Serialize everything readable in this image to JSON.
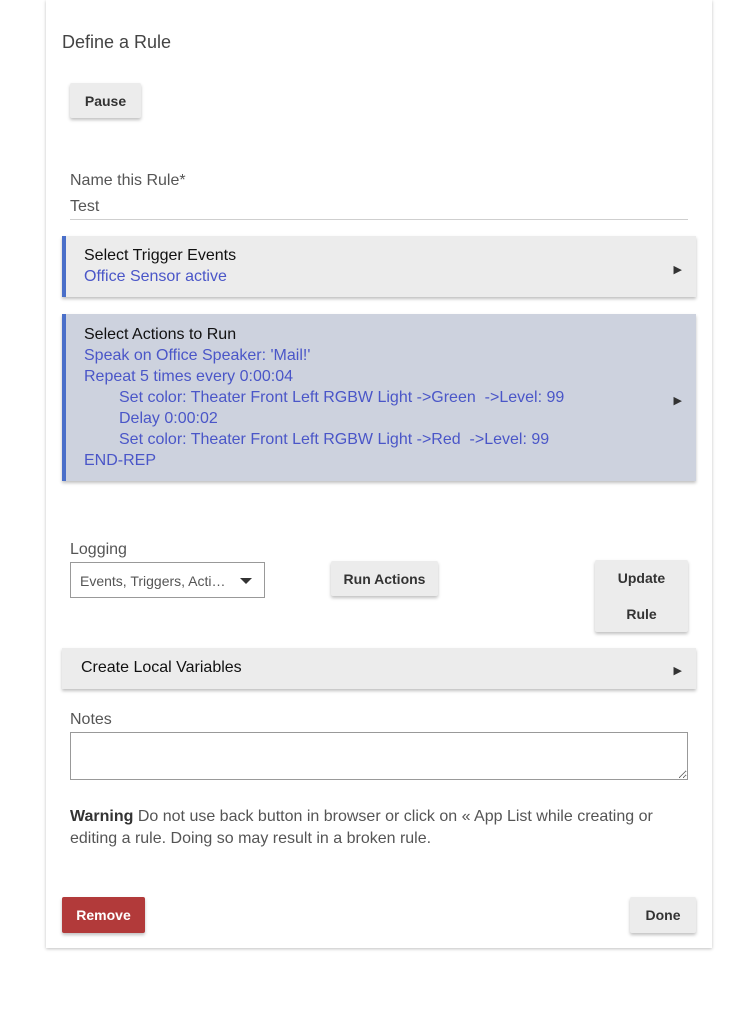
{
  "page": {
    "title": "Define a Rule"
  },
  "buttons": {
    "pause": "Pause",
    "run_actions": "Run Actions",
    "update_line1": "Update",
    "update_line2": "Rule",
    "remove": "Remove",
    "done": "Done"
  },
  "name_field": {
    "label": "Name this Rule*",
    "value": "Test"
  },
  "trigger_section": {
    "heading": "Select Trigger Events",
    "lines": [
      "Office Sensor active"
    ]
  },
  "actions_section": {
    "heading": "Select Actions to Run",
    "lines": [
      "Speak on Office Speaker: 'Mail!'",
      "Repeat 5 times every 0:00:04",
      "Set color: Theater Front Left RGBW Light ->Green  ->Level: 99",
      "Delay 0:00:02",
      "Set color: Theater Front Left RGBW Light ->Red  ->Level: 99",
      "END-REP"
    ]
  },
  "logging": {
    "label": "Logging",
    "selected": "Events, Triggers, Actions"
  },
  "local_variables": {
    "heading": "Create Local Variables"
  },
  "notes": {
    "label": "Notes",
    "value": ""
  },
  "warning": {
    "bold": "Warning",
    "text": " Do not use back button in browser or click on « App List while creating or editing a rule. Doing so may result in a broken rule."
  },
  "icons": {
    "section_arrow": "triangle-right-icon",
    "dropdown": "caret-down-icon"
  },
  "colors": {
    "accent": "#4a6fc9",
    "link_text": "#4a56c8",
    "actions_bg": "#cdd2de",
    "remove_bg": "#b23a3a"
  }
}
